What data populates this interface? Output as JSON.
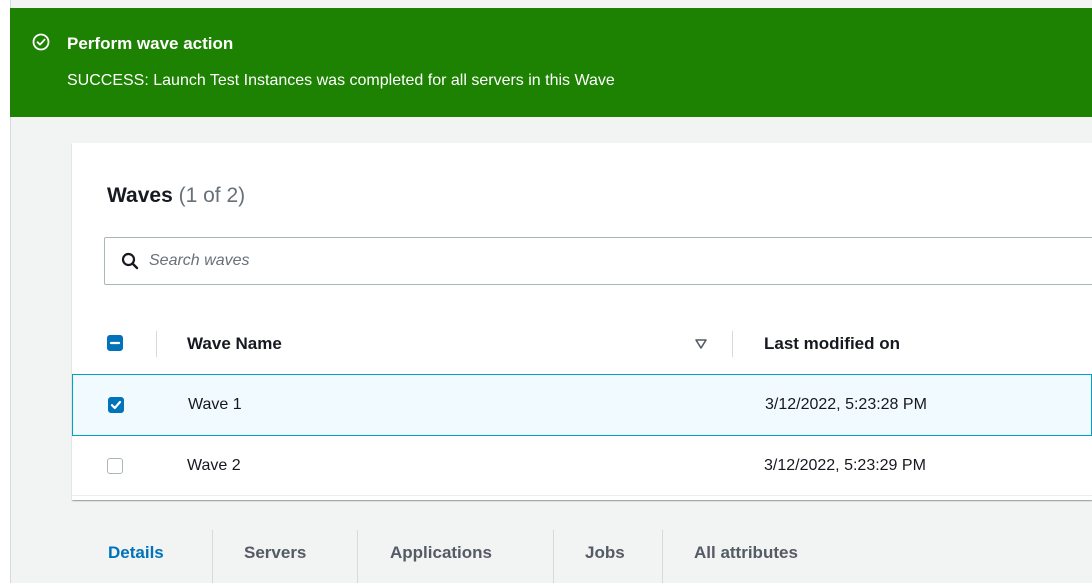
{
  "banner": {
    "title": "Perform wave action",
    "message": "SUCCESS: Launch Test Instances was completed for all servers in this Wave",
    "color": "#1d8102",
    "icon": "check-circle-icon"
  },
  "panel": {
    "title": "Waves",
    "count": "(1 of 2)"
  },
  "search": {
    "placeholder": "Search waves",
    "value": "",
    "icon": "search-icon"
  },
  "table": {
    "columns": [
      "Wave Name",
      "Last modified on"
    ],
    "sort_icon": "sort-down-triangle-icon",
    "select_all_state": "indeterminate",
    "rows": [
      {
        "name": "Wave 1",
        "modified": "3/12/2022, 5:23:28 PM",
        "selected": true
      },
      {
        "name": "Wave 2",
        "modified": "3/12/2022, 5:23:29 PM",
        "selected": false
      }
    ]
  },
  "tabs": [
    "Details",
    "Servers",
    "Applications",
    "Jobs",
    "All attributes"
  ],
  "active_tab": "Details",
  "colors": {
    "accent": "#0073bb",
    "selected_row_bg": "#f1faff",
    "selected_row_border": "#00a1c9"
  }
}
